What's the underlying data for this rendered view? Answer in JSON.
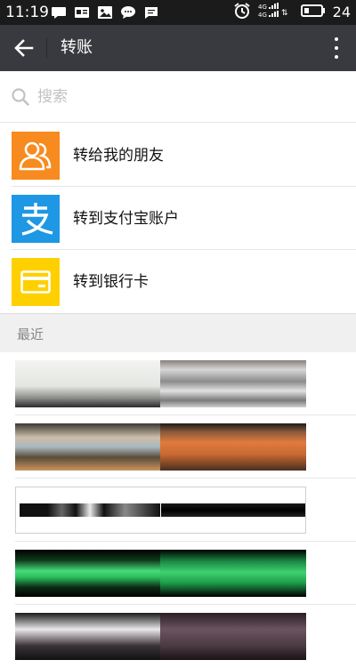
{
  "status_bar": {
    "time": "11:19",
    "battery_level": "24",
    "notification_icons": [
      "message-bubble-icon",
      "id-card-icon",
      "photo-icon",
      "chat-icon",
      "sms-icon"
    ],
    "status_icons": [
      "alarm-icon",
      "signal-4g-icon",
      "battery-icon"
    ]
  },
  "header": {
    "title": "转账",
    "background": "#393a3f"
  },
  "search": {
    "placeholder": "搜索"
  },
  "options": [
    {
      "label": "转给我的朋友",
      "icon": "contacts-icon",
      "color": "#f78b1f"
    },
    {
      "label": "转到支付宝账户",
      "icon": "alipay-icon",
      "color": "#1e97e5"
    },
    {
      "label": "转到银行卡",
      "icon": "bank-card-icon",
      "color": "#ffd000"
    }
  ],
  "recent": {
    "header": "最近",
    "items_count": 5
  },
  "colors": {
    "page_bg": "#ffffff",
    "section_bg": "#f0f0f0",
    "separator": "#e6e6e6"
  }
}
